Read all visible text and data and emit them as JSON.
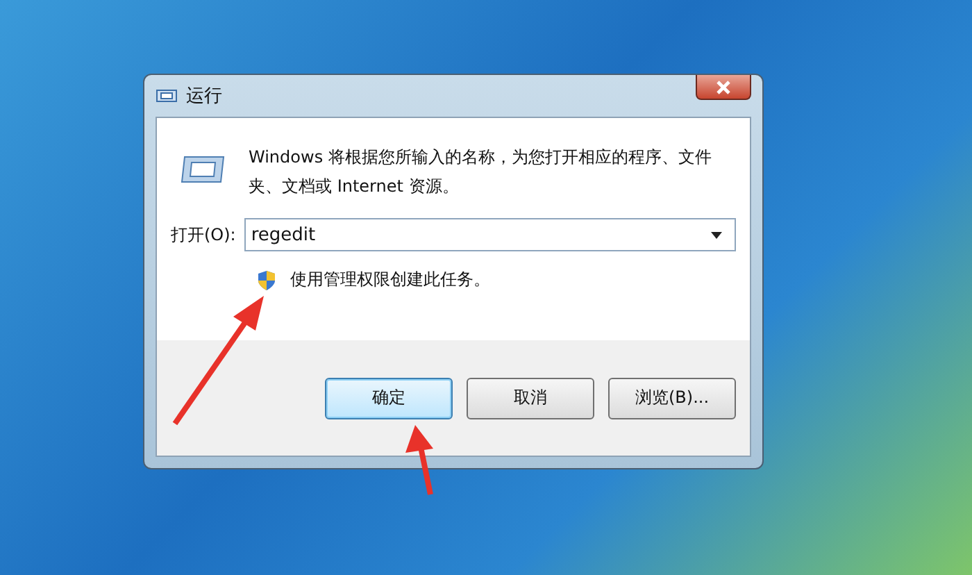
{
  "window": {
    "title": "运行"
  },
  "description": "Windows 将根据您所输入的名称，为您打开相应的程序、文件夹、文档或 Internet 资源。",
  "open_field": {
    "label": "打开(O):",
    "value": "regedit"
  },
  "admin_note": "使用管理权限创建此任务。",
  "buttons": [
    {
      "label": "确定",
      "selected": true
    },
    {
      "label": "取消",
      "selected": false
    },
    {
      "label": "浏览(B)...",
      "selected": false
    }
  ]
}
